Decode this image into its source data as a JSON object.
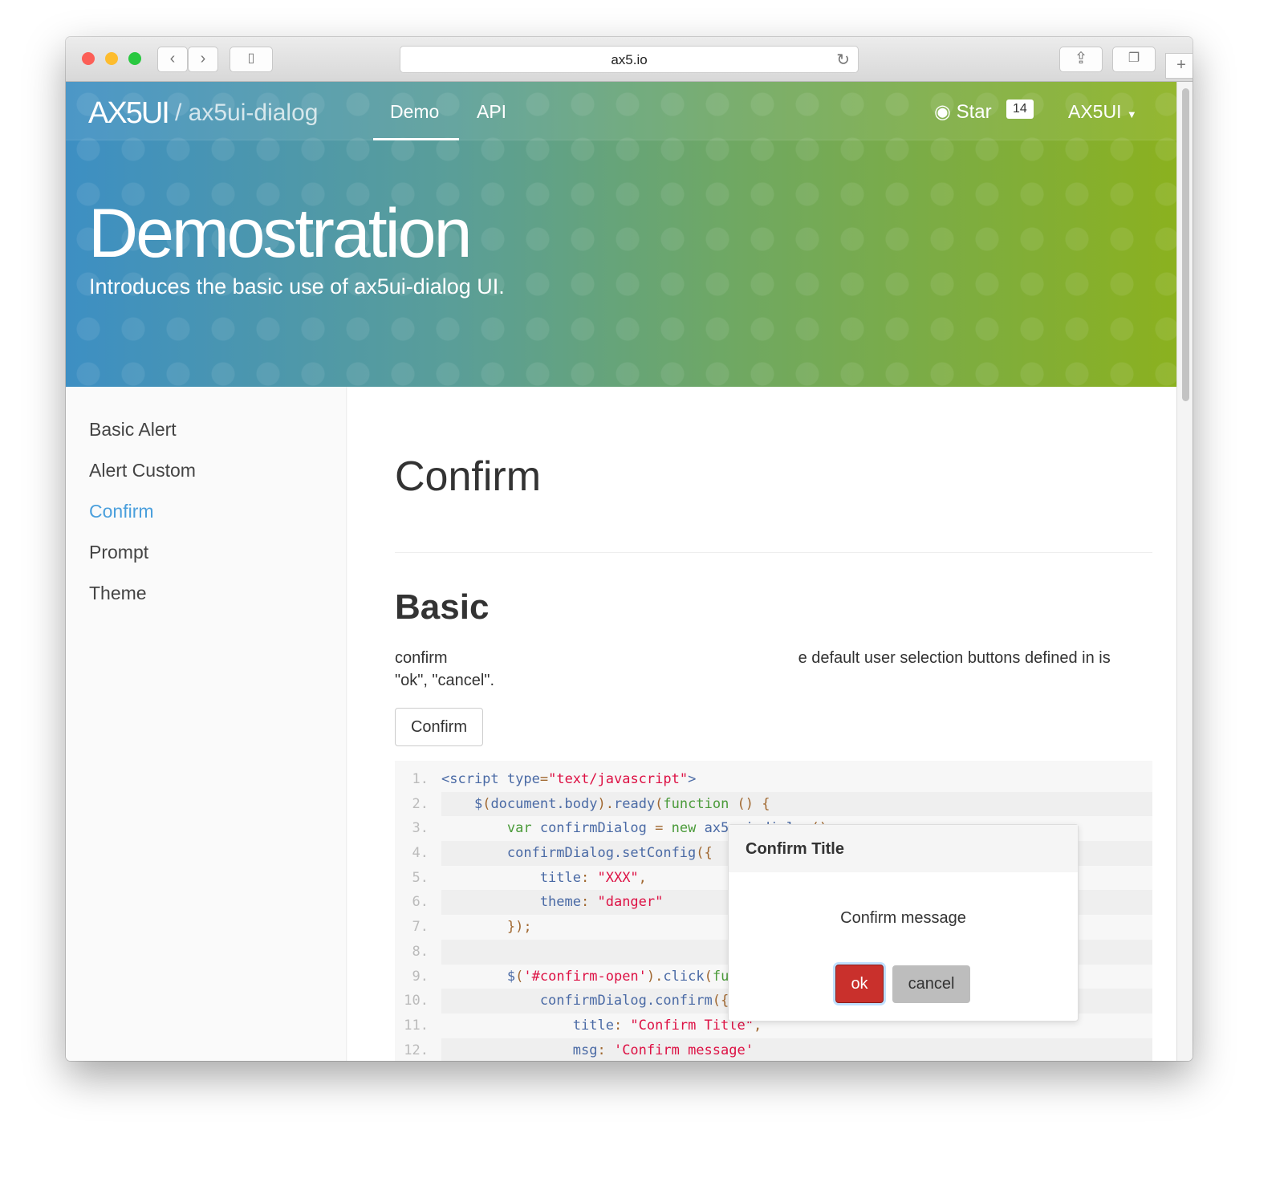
{
  "browser": {
    "url": "ax5.io"
  },
  "nav": {
    "logo": "AX5UI",
    "repo": "/ ax5ui-dialog",
    "links": [
      "Demo",
      "API"
    ],
    "star_label": "Star",
    "star_count": "14",
    "menu": "AX5UI"
  },
  "hero": {
    "title": "Demostration",
    "subtitle": "Introduces the basic use of ax5ui-dialog UI."
  },
  "sidebar": {
    "items": [
      {
        "label": "Basic Alert"
      },
      {
        "label": "Alert Custom"
      },
      {
        "label": "Confirm",
        "active": true
      },
      {
        "label": "Prompt"
      },
      {
        "label": "Theme"
      }
    ],
    "active_color": "#4a9fdc"
  },
  "main": {
    "heading": "Confirm",
    "subheading": "Basic",
    "para_start": "confirm",
    "para_end": "e default user selection buttons defined in is",
    "para_line2": "\"ok\", \"cancel\".",
    "button": "Confirm"
  },
  "code": [
    [
      [
        "tag",
        "<script "
      ],
      [
        "id",
        "type"
      ],
      [
        "pun",
        "="
      ],
      [
        "str",
        "\"text/javascript\""
      ],
      [
        "tag",
        ">"
      ]
    ],
    [
      [
        "id",
        "    $"
      ],
      [
        "pun",
        "("
      ],
      [
        "id",
        "document.body"
      ],
      [
        "pun",
        ")."
      ],
      [
        "id",
        "ready"
      ],
      [
        "pun",
        "("
      ],
      [
        "kw",
        "function"
      ],
      [
        "pun",
        " () {"
      ]
    ],
    [
      [
        "kw",
        "        var "
      ],
      [
        "id",
        "confirmDialog"
      ],
      [
        "pun",
        " = "
      ],
      [
        "kw",
        "new "
      ],
      [
        "id",
        "ax5.ui.dialog"
      ],
      [
        "pun",
        "();"
      ]
    ],
    [
      [
        "id",
        "        confirmDialog.setConfig"
      ],
      [
        "pun",
        "({"
      ]
    ],
    [
      [
        "id",
        "            title"
      ],
      [
        "pun",
        ": "
      ],
      [
        "str",
        "\"XXX\""
      ],
      [
        "pun",
        ","
      ]
    ],
    [
      [
        "id",
        "            theme"
      ],
      [
        "pun",
        ": "
      ],
      [
        "str",
        "\"danger\""
      ]
    ],
    [
      [
        "pun",
        "        });"
      ]
    ],
    [],
    [
      [
        "id",
        "        $"
      ],
      [
        "pun",
        "("
      ],
      [
        "str",
        "'#confirm-open'"
      ],
      [
        "pun",
        ")."
      ],
      [
        "id",
        "click"
      ],
      [
        "pun",
        "("
      ],
      [
        "kw",
        "function"
      ],
      [
        "pun",
        " () {"
      ]
    ],
    [
      [
        "id",
        "            confirmDialog.confirm"
      ],
      [
        "pun",
        "({"
      ]
    ],
    [
      [
        "id",
        "                title"
      ],
      [
        "pun",
        ": "
      ],
      [
        "str",
        "\"Confirm Title\""
      ],
      [
        "pun",
        ","
      ]
    ],
    [
      [
        "id",
        "                msg"
      ],
      [
        "pun",
        ": "
      ],
      [
        "str",
        "'Confirm message'"
      ]
    ]
  ],
  "dialog": {
    "title": "Confirm Title",
    "message": "Confirm message",
    "ok": "ok",
    "cancel": "cancel",
    "ok_color": "#c9302c"
  }
}
